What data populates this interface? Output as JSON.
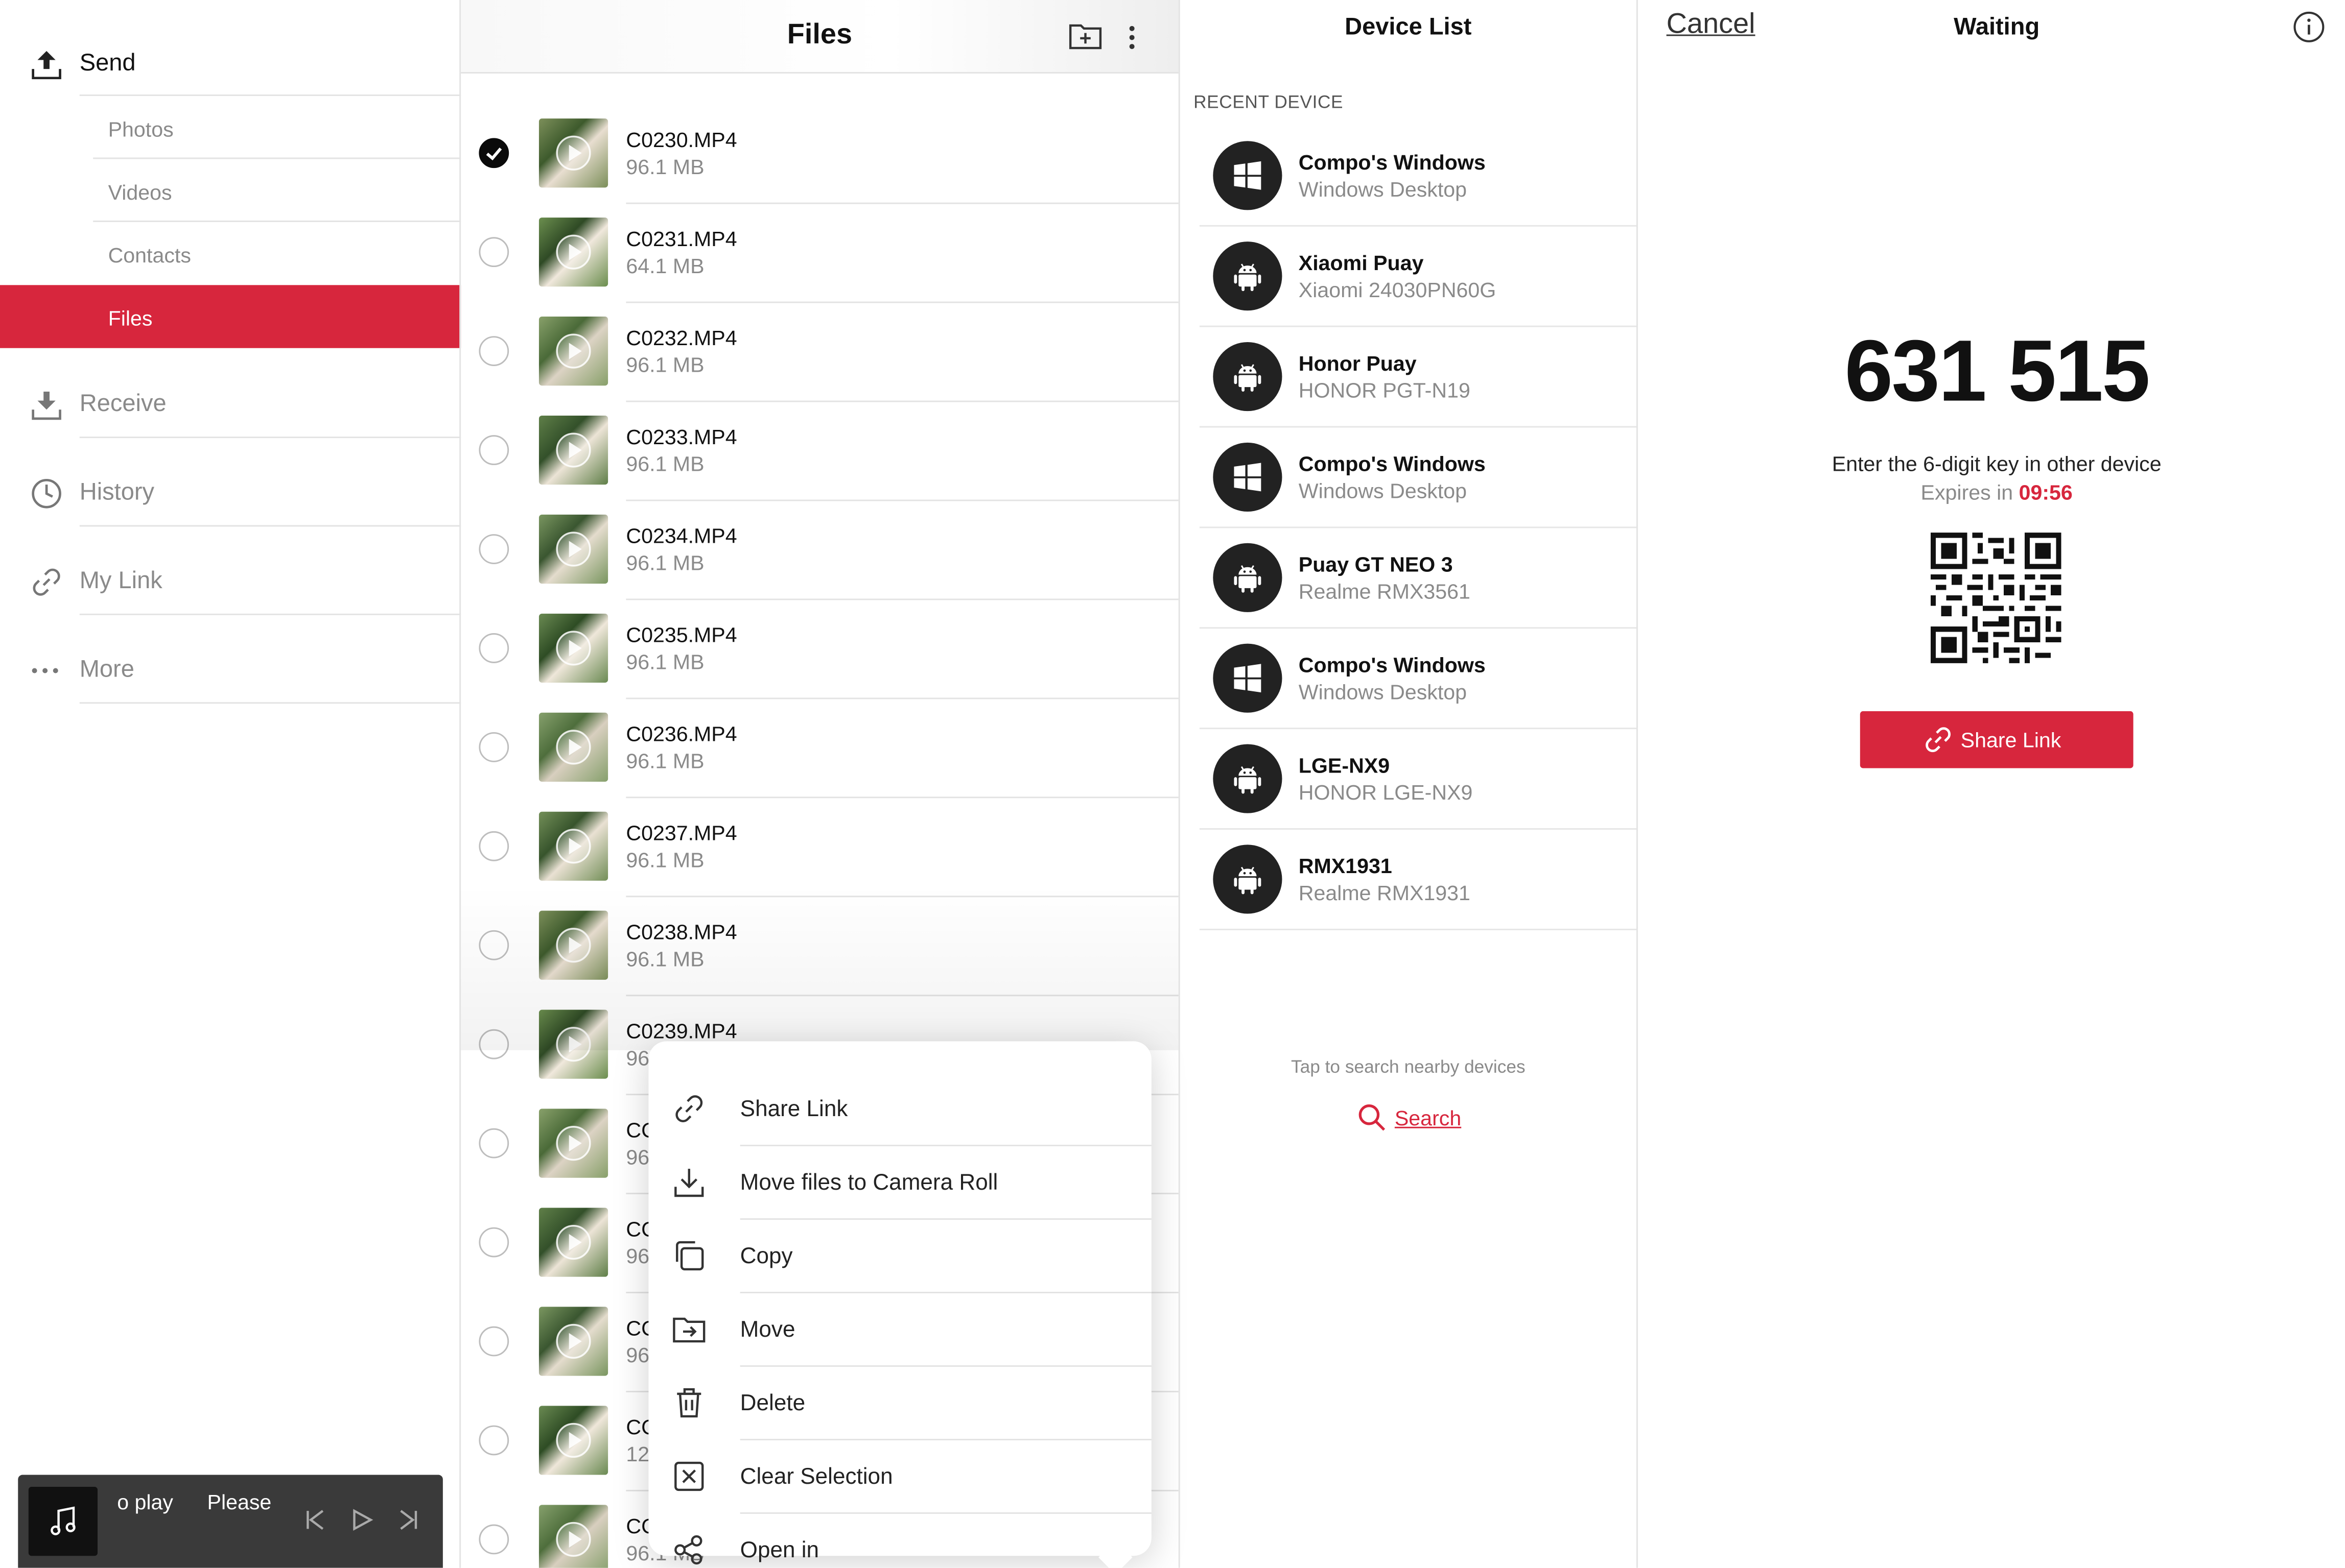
{
  "sidebar": {
    "send_label": "Send",
    "send_subitems": [
      "Photos",
      "Videos",
      "Contacts",
      "Files"
    ],
    "active_subitem": "Files",
    "receive_label": "Receive",
    "history_label": "History",
    "mylink_label": "My Link",
    "more_label": "More"
  },
  "mini_player": {
    "text_left": "o play",
    "text_right": "Please"
  },
  "files_panel": {
    "title": "Files",
    "files": [
      {
        "name": "C0230.MP4",
        "size": "96.1 MB",
        "selected": true
      },
      {
        "name": "C0231.MP4",
        "size": "64.1 MB",
        "selected": false
      },
      {
        "name": "C0232.MP4",
        "size": "96.1 MB",
        "selected": false
      },
      {
        "name": "C0233.MP4",
        "size": "96.1 MB",
        "selected": false
      },
      {
        "name": "C0234.MP4",
        "size": "96.1 MB",
        "selected": false
      },
      {
        "name": "C0235.MP4",
        "size": "96.1 MB",
        "selected": false
      },
      {
        "name": "C0236.MP4",
        "size": "96.1 MB",
        "selected": false
      },
      {
        "name": "C0237.MP4",
        "size": "96.1 MB",
        "selected": false
      },
      {
        "name": "C0238.MP4",
        "size": "96.1 MB",
        "selected": false
      },
      {
        "name": "C0239.MP4",
        "size": "96",
        "selected": false
      },
      {
        "name": "CC",
        "size": "96",
        "selected": false
      },
      {
        "name": "CC",
        "size": "96",
        "selected": false
      },
      {
        "name": "CC",
        "size": "96",
        "selected": false
      },
      {
        "name": "CC",
        "size": "12",
        "selected": false
      },
      {
        "name": "CC",
        "size": "96.1 MB",
        "selected": false
      }
    ]
  },
  "context_menu": {
    "items": [
      {
        "label": "Share Link",
        "icon": "link-icon"
      },
      {
        "label": "Move files to Camera Roll",
        "icon": "download-icon"
      },
      {
        "label": "Copy",
        "icon": "copy-icon"
      },
      {
        "label": "Move",
        "icon": "move-folder-icon"
      },
      {
        "label": "Delete",
        "icon": "trash-icon"
      },
      {
        "label": "Clear Selection",
        "icon": "clear-selection-icon"
      },
      {
        "label": "Open in",
        "icon": "share-nodes-icon"
      }
    ]
  },
  "device_list": {
    "title": "Device List",
    "section_label": "RECENT DEVICE",
    "devices": [
      {
        "name": "Compo's Windows",
        "model": "Windows Desktop",
        "os": "windows"
      },
      {
        "name": "Xiaomi Puay",
        "model": "Xiaomi 24030PN60G",
        "os": "android"
      },
      {
        "name": "Honor Puay",
        "model": "HONOR PGT-N19",
        "os": "android"
      },
      {
        "name": "Compo's Windows",
        "model": "Windows Desktop",
        "os": "windows"
      },
      {
        "name": "Puay GT NEO 3",
        "model": "Realme RMX3561",
        "os": "android"
      },
      {
        "name": "Compo's Windows",
        "model": "Windows Desktop",
        "os": "windows"
      },
      {
        "name": "LGE-NX9",
        "model": "HONOR LGE-NX9",
        "os": "android"
      },
      {
        "name": "RMX1931",
        "model": "Realme RMX1931",
        "os": "android"
      }
    ],
    "tap_hint": "Tap to search nearby devices",
    "search_label": "Search"
  },
  "waiting_panel": {
    "cancel_label": "Cancel",
    "title": "Waiting",
    "key": "631 515",
    "instruction": "Enter the 6-digit key in other device",
    "expires_prefix": "Expires in",
    "expires_time": "09:56",
    "share_link_label": "Share Link"
  },
  "colors": {
    "accent_red": "#d7263d",
    "text_dark": "#111111",
    "text_gray": "#8a8a8a",
    "divider": "#e3e3e3"
  }
}
